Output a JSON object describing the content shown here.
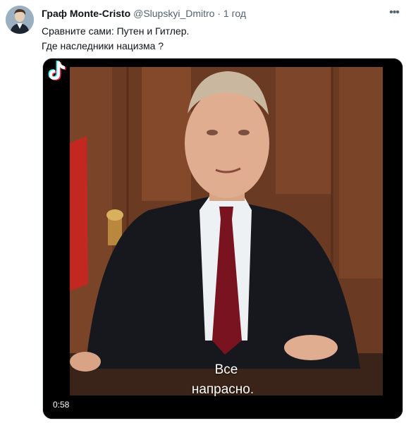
{
  "tweet": {
    "author_name": "Граф Monte-Cristo",
    "handle": "@Slupskyi_Dmitro",
    "separator": "·",
    "time": "1 год",
    "more_icon": "ellipsis-icon",
    "text_lines": [
      "Сравните сами: Путен и Гитлер.",
      "Где наследники нацизма ?"
    ]
  },
  "media": {
    "caption_line1": "Все",
    "caption_line2": "напрасно.",
    "duration": "0:58",
    "watermark_icon": "tiktok-logo-icon"
  }
}
